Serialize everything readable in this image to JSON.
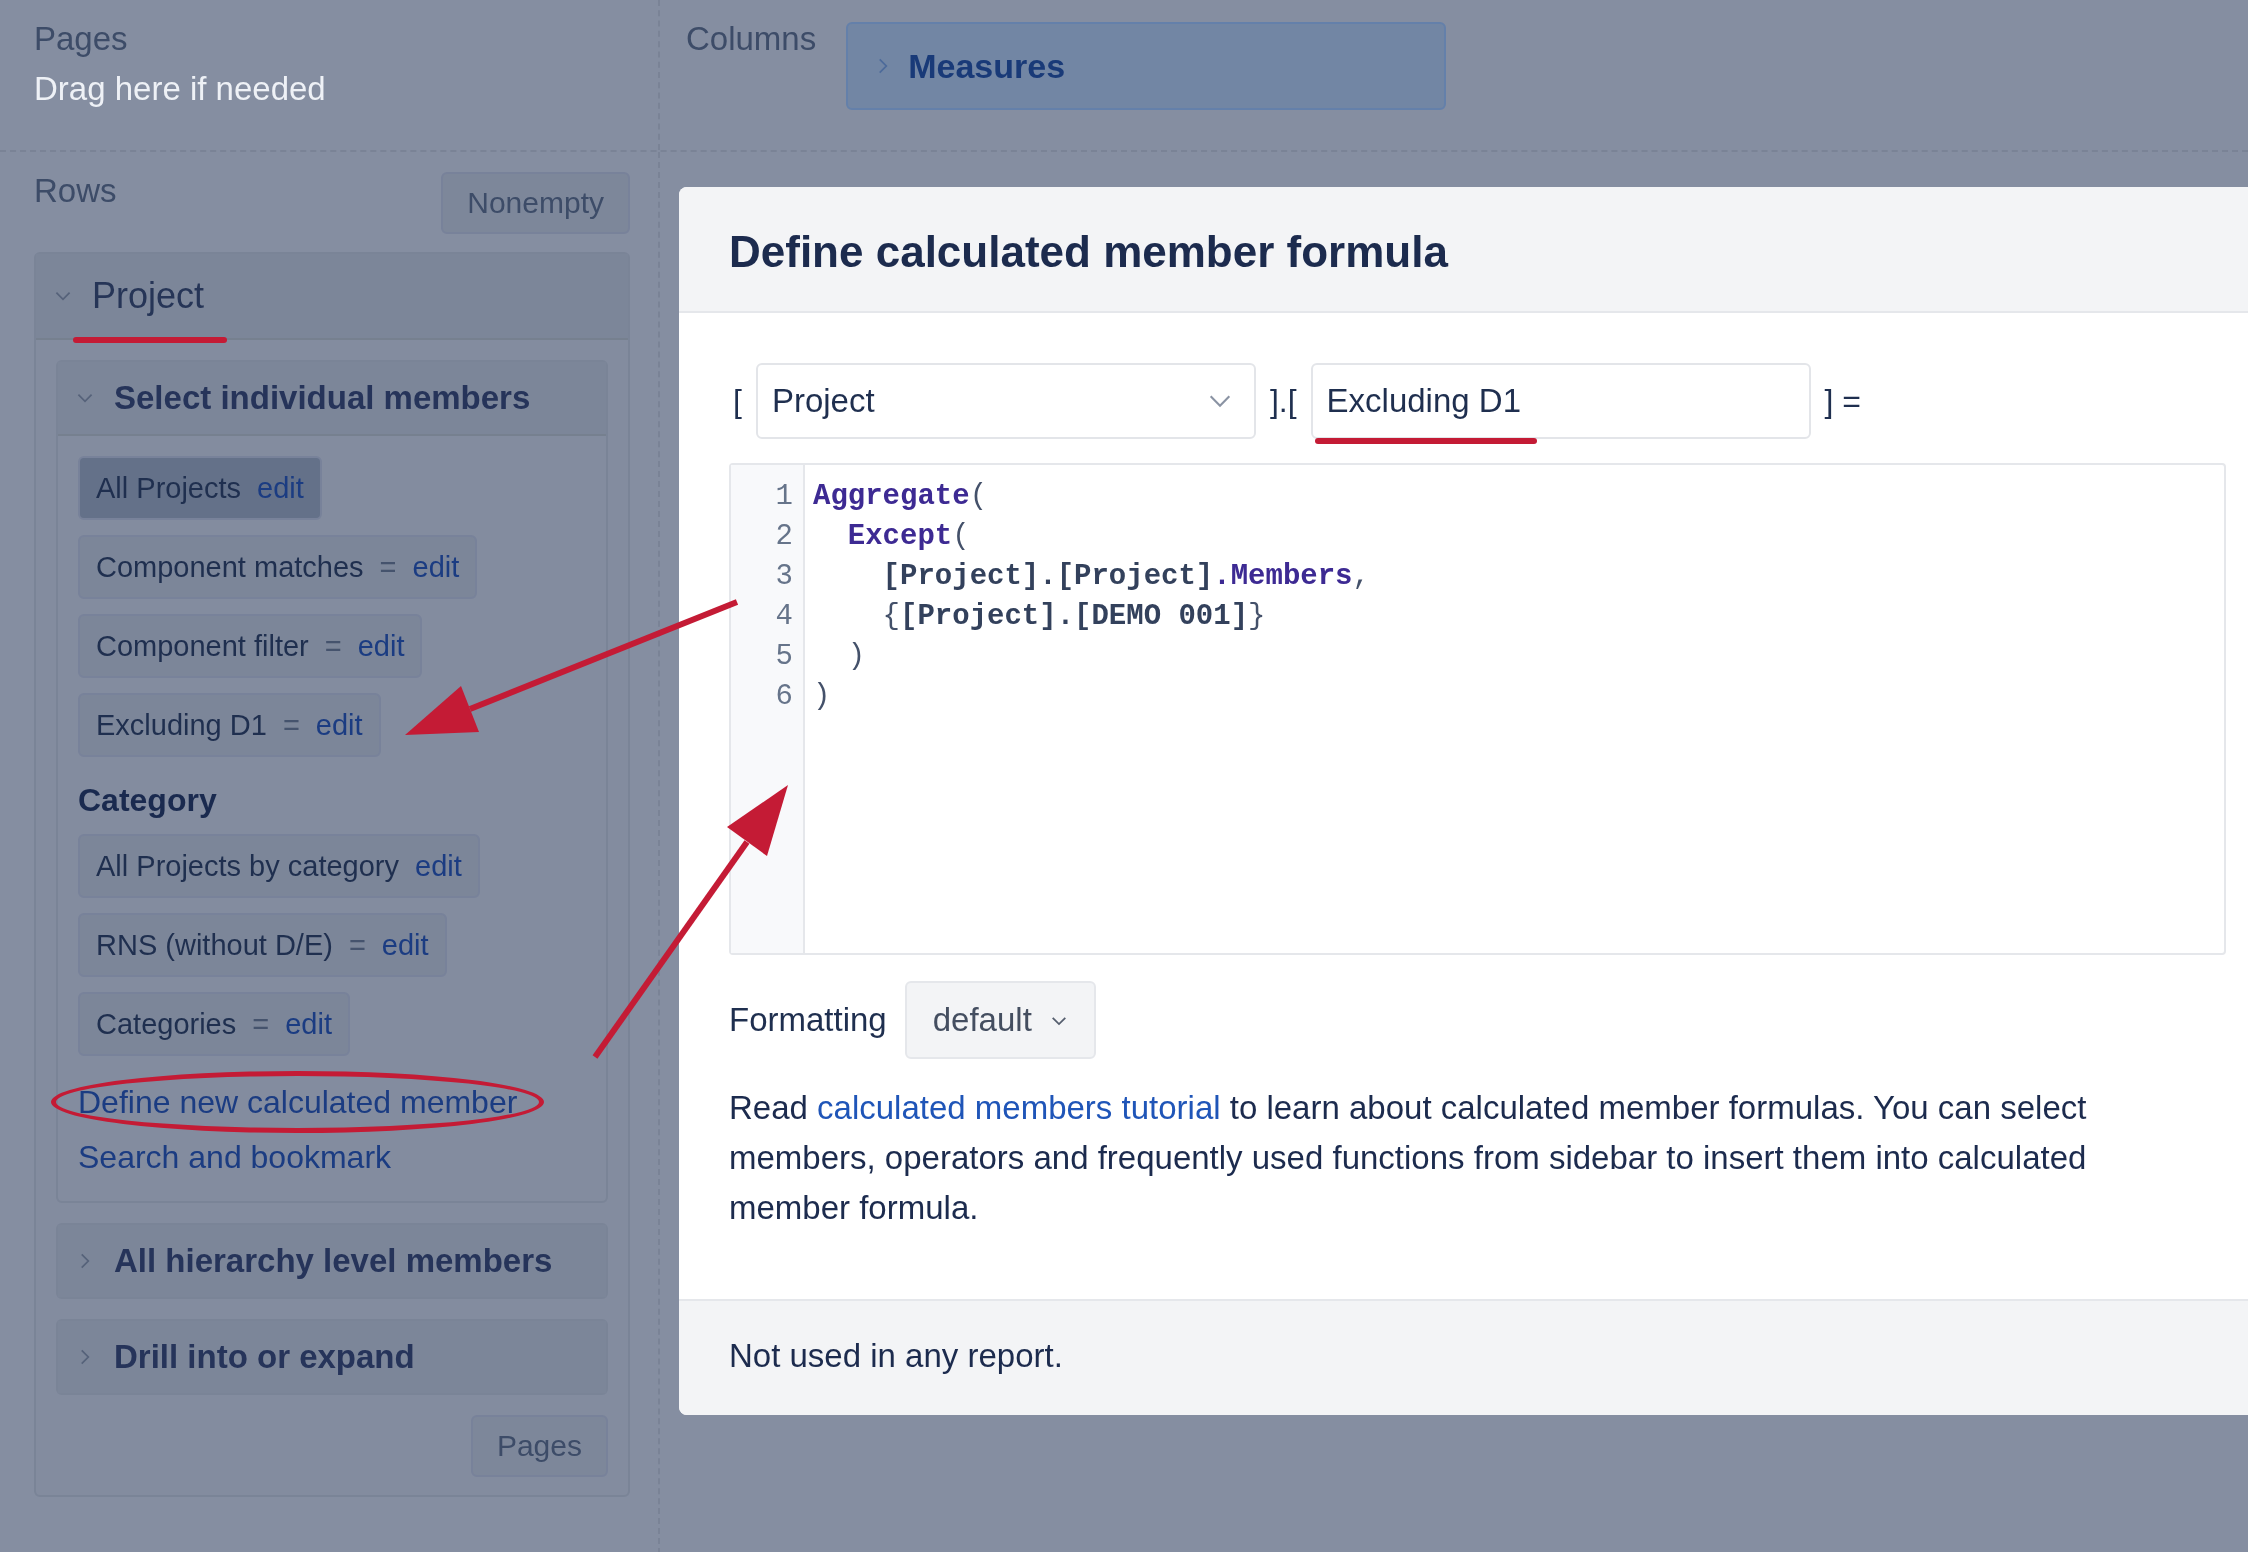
{
  "pages": {
    "label": "Pages",
    "placeholder": "Drag here if needed"
  },
  "columns": {
    "label": "Columns",
    "items": [
      {
        "label": "Measures",
        "expanded": false
      }
    ]
  },
  "rows": {
    "label": "Rows",
    "nonempty_button": "Nonempty",
    "pages_button": "Pages",
    "dimension": {
      "label": "Project",
      "expanded": true,
      "sections": [
        {
          "title": "Select individual members",
          "expanded": true,
          "groups": [
            {
              "members": [
                {
                  "name": "All Projects",
                  "link": "edit",
                  "selected": true
                },
                {
                  "name": "Component matches",
                  "operator": "=",
                  "link": "edit",
                  "selected": false
                },
                {
                  "name": "Component filter",
                  "operator": "=",
                  "link": "edit",
                  "selected": false
                },
                {
                  "name": "Excluding D1",
                  "operator": "=",
                  "link": "edit",
                  "selected": false
                }
              ]
            },
            {
              "heading": "Category",
              "members": [
                {
                  "name": "All Projects by category",
                  "link": "edit",
                  "selected": false
                },
                {
                  "name": "RNS (without D/E)",
                  "operator": "=",
                  "link": "edit",
                  "selected": false
                },
                {
                  "name": "Categories",
                  "operator": "=",
                  "link": "edit",
                  "selected": false
                }
              ]
            }
          ],
          "links": [
            "Define new calculated member",
            "Search and bookmark"
          ]
        },
        {
          "title": "All hierarchy level members",
          "expanded": false
        },
        {
          "title": "Drill into or expand",
          "expanded": false
        }
      ]
    }
  },
  "dialog": {
    "title": "Define calculated member formula",
    "open_bracket": "[",
    "dimension_select": "Project",
    "separator": "].[",
    "member_name": "Excluding D1",
    "close_bracket": "] =",
    "editor_lines": [
      {
        "number": "1",
        "tokens": [
          {
            "kind": "function",
            "text": "Aggregate"
          },
          {
            "kind": "punct",
            "text": "("
          }
        ]
      },
      {
        "number": "2",
        "tokens": [
          {
            "kind": "function",
            "text": "  Except"
          },
          {
            "kind": "punct",
            "text": "("
          }
        ]
      },
      {
        "number": "3",
        "tokens": [
          {
            "kind": "ident",
            "text": "    [Project].[Project]"
          },
          {
            "kind": "function",
            "text": ".Members"
          },
          {
            "kind": "punct",
            "text": ","
          }
        ]
      },
      {
        "number": "4",
        "tokens": [
          {
            "kind": "punct",
            "text": "    {"
          },
          {
            "kind": "ident",
            "text": "[Project].[DEMO 001]"
          },
          {
            "kind": "punct",
            "text": "}"
          }
        ]
      },
      {
        "number": "5",
        "tokens": [
          {
            "kind": "punct",
            "text": "  )"
          }
        ]
      },
      {
        "number": "6",
        "tokens": [
          {
            "kind": "punct",
            "text": ")"
          }
        ]
      }
    ],
    "formatting_label": "Formatting",
    "formatting_select": "default",
    "help": {
      "before": "Read ",
      "link": "calculated members tutorial",
      "after": " to learn about calculated member formulas. You can select members, operators and frequently used functions from sidebar to insert them into calculated member formula."
    },
    "footer": "Not used in any report."
  }
}
